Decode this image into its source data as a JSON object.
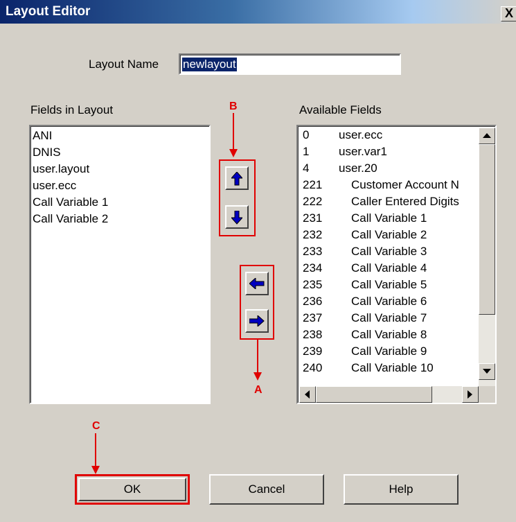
{
  "window": {
    "title": "Layout Editor",
    "close_glyph": "X"
  },
  "layout_name": {
    "label": "Layout Name",
    "value": "newlayout"
  },
  "fields_in_layout": {
    "label": "Fields in Layout",
    "items": [
      "ANI",
      "DNIS",
      "user.layout",
      "user.ecc",
      "Call Variable 1",
      "Call Variable 2"
    ]
  },
  "available_fields": {
    "label": "Available Fields",
    "items": [
      {
        "id": "0",
        "name": "user.ecc"
      },
      {
        "id": "1",
        "name": "user.var1"
      },
      {
        "id": "4",
        "name": "user.20"
      },
      {
        "id": "221",
        "name": "Customer Account N"
      },
      {
        "id": "222",
        "name": "Caller Entered Digits"
      },
      {
        "id": "231",
        "name": "Call Variable 1"
      },
      {
        "id": "232",
        "name": "Call Variable 2"
      },
      {
        "id": "233",
        "name": "Call Variable 3"
      },
      {
        "id": "234",
        "name": "Call Variable 4"
      },
      {
        "id": "235",
        "name": "Call Variable 5"
      },
      {
        "id": "236",
        "name": "Call Variable 6"
      },
      {
        "id": "237",
        "name": "Call Variable 7"
      },
      {
        "id": "238",
        "name": "Call Variable 8"
      },
      {
        "id": "239",
        "name": "Call Variable 9"
      },
      {
        "id": "240",
        "name": "Call Variable 10"
      }
    ]
  },
  "annotations": {
    "a": "A",
    "b": "B",
    "c": "C"
  },
  "buttons": {
    "ok": "OK",
    "cancel": "Cancel",
    "help": "Help"
  },
  "icons": {
    "move_up": "arrow-up-icon",
    "move_down": "arrow-down-icon",
    "add_left": "arrow-left-icon",
    "remove_right": "arrow-right-icon"
  },
  "colors": {
    "title_bar": "#0a246a",
    "dialog_bg": "#d4d0c8",
    "annotation": "#e00000",
    "arrow_icon": "#0000c0"
  }
}
